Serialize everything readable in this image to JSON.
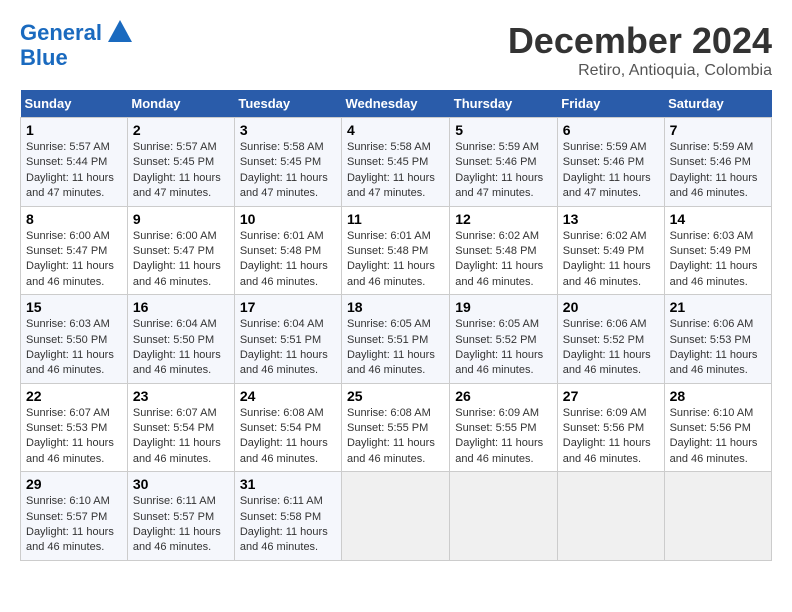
{
  "header": {
    "logo_line1": "General",
    "logo_line2": "Blue",
    "month": "December 2024",
    "location": "Retiro, Antioquia, Colombia"
  },
  "weekdays": [
    "Sunday",
    "Monday",
    "Tuesday",
    "Wednesday",
    "Thursday",
    "Friday",
    "Saturday"
  ],
  "weeks": [
    [
      {
        "day": "1",
        "sunrise": "5:57 AM",
        "sunset": "5:44 PM",
        "daylight": "11 hours and 47 minutes."
      },
      {
        "day": "2",
        "sunrise": "5:57 AM",
        "sunset": "5:45 PM",
        "daylight": "11 hours and 47 minutes."
      },
      {
        "day": "3",
        "sunrise": "5:58 AM",
        "sunset": "5:45 PM",
        "daylight": "11 hours and 47 minutes."
      },
      {
        "day": "4",
        "sunrise": "5:58 AM",
        "sunset": "5:45 PM",
        "daylight": "11 hours and 47 minutes."
      },
      {
        "day": "5",
        "sunrise": "5:59 AM",
        "sunset": "5:46 PM",
        "daylight": "11 hours and 47 minutes."
      },
      {
        "day": "6",
        "sunrise": "5:59 AM",
        "sunset": "5:46 PM",
        "daylight": "11 hours and 47 minutes."
      },
      {
        "day": "7",
        "sunrise": "5:59 AM",
        "sunset": "5:46 PM",
        "daylight": "11 hours and 46 minutes."
      }
    ],
    [
      {
        "day": "8",
        "sunrise": "6:00 AM",
        "sunset": "5:47 PM",
        "daylight": "11 hours and 46 minutes."
      },
      {
        "day": "9",
        "sunrise": "6:00 AM",
        "sunset": "5:47 PM",
        "daylight": "11 hours and 46 minutes."
      },
      {
        "day": "10",
        "sunrise": "6:01 AM",
        "sunset": "5:48 PM",
        "daylight": "11 hours and 46 minutes."
      },
      {
        "day": "11",
        "sunrise": "6:01 AM",
        "sunset": "5:48 PM",
        "daylight": "11 hours and 46 minutes."
      },
      {
        "day": "12",
        "sunrise": "6:02 AM",
        "sunset": "5:48 PM",
        "daylight": "11 hours and 46 minutes."
      },
      {
        "day": "13",
        "sunrise": "6:02 AM",
        "sunset": "5:49 PM",
        "daylight": "11 hours and 46 minutes."
      },
      {
        "day": "14",
        "sunrise": "6:03 AM",
        "sunset": "5:49 PM",
        "daylight": "11 hours and 46 minutes."
      }
    ],
    [
      {
        "day": "15",
        "sunrise": "6:03 AM",
        "sunset": "5:50 PM",
        "daylight": "11 hours and 46 minutes."
      },
      {
        "day": "16",
        "sunrise": "6:04 AM",
        "sunset": "5:50 PM",
        "daylight": "11 hours and 46 minutes."
      },
      {
        "day": "17",
        "sunrise": "6:04 AM",
        "sunset": "5:51 PM",
        "daylight": "11 hours and 46 minutes."
      },
      {
        "day": "18",
        "sunrise": "6:05 AM",
        "sunset": "5:51 PM",
        "daylight": "11 hours and 46 minutes."
      },
      {
        "day": "19",
        "sunrise": "6:05 AM",
        "sunset": "5:52 PM",
        "daylight": "11 hours and 46 minutes."
      },
      {
        "day": "20",
        "sunrise": "6:06 AM",
        "sunset": "5:52 PM",
        "daylight": "11 hours and 46 minutes."
      },
      {
        "day": "21",
        "sunrise": "6:06 AM",
        "sunset": "5:53 PM",
        "daylight": "11 hours and 46 minutes."
      }
    ],
    [
      {
        "day": "22",
        "sunrise": "6:07 AM",
        "sunset": "5:53 PM",
        "daylight": "11 hours and 46 minutes."
      },
      {
        "day": "23",
        "sunrise": "6:07 AM",
        "sunset": "5:54 PM",
        "daylight": "11 hours and 46 minutes."
      },
      {
        "day": "24",
        "sunrise": "6:08 AM",
        "sunset": "5:54 PM",
        "daylight": "11 hours and 46 minutes."
      },
      {
        "day": "25",
        "sunrise": "6:08 AM",
        "sunset": "5:55 PM",
        "daylight": "11 hours and 46 minutes."
      },
      {
        "day": "26",
        "sunrise": "6:09 AM",
        "sunset": "5:55 PM",
        "daylight": "11 hours and 46 minutes."
      },
      {
        "day": "27",
        "sunrise": "6:09 AM",
        "sunset": "5:56 PM",
        "daylight": "11 hours and 46 minutes."
      },
      {
        "day": "28",
        "sunrise": "6:10 AM",
        "sunset": "5:56 PM",
        "daylight": "11 hours and 46 minutes."
      }
    ],
    [
      {
        "day": "29",
        "sunrise": "6:10 AM",
        "sunset": "5:57 PM",
        "daylight": "11 hours and 46 minutes."
      },
      {
        "day": "30",
        "sunrise": "6:11 AM",
        "sunset": "5:57 PM",
        "daylight": "11 hours and 46 minutes."
      },
      {
        "day": "31",
        "sunrise": "6:11 AM",
        "sunset": "5:58 PM",
        "daylight": "11 hours and 46 minutes."
      },
      null,
      null,
      null,
      null
    ]
  ]
}
